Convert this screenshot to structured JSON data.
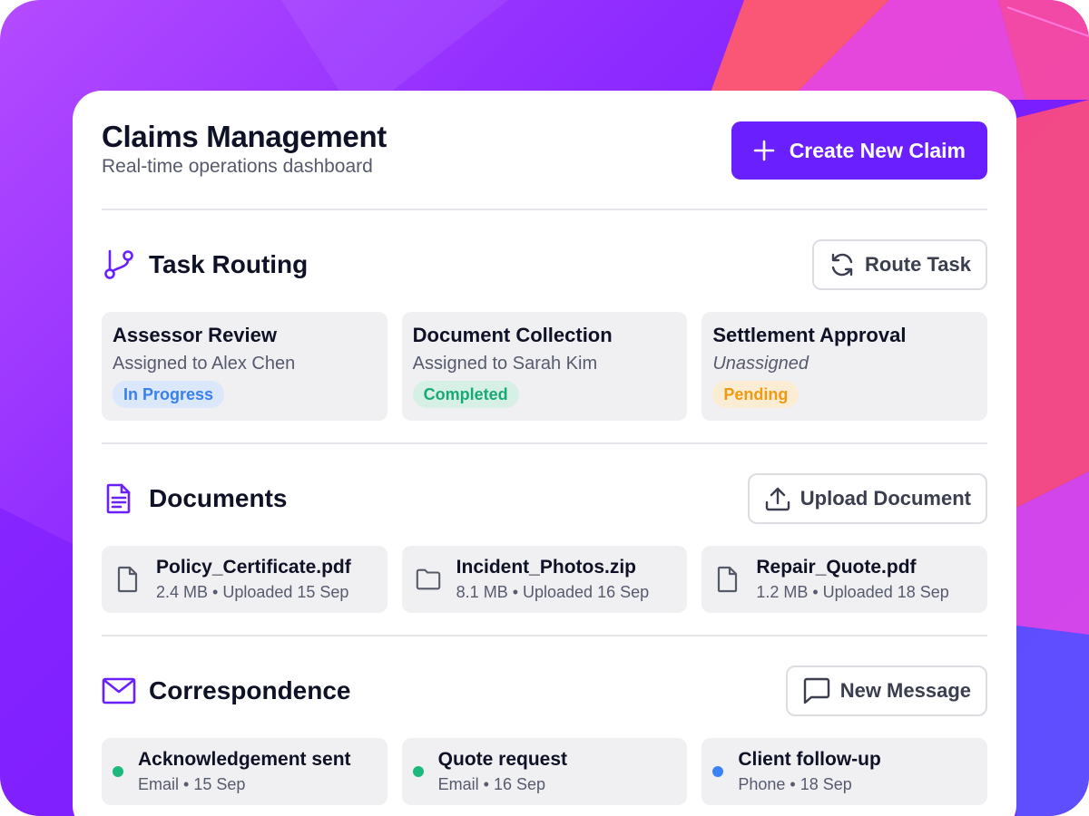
{
  "header": {
    "title": "Claims Management",
    "subtitle": "Real-time operations dashboard",
    "create_label": "Create New Claim"
  },
  "task_routing": {
    "title": "Task Routing",
    "action_label": "Route Task",
    "tasks": [
      {
        "name": "Assessor Review",
        "assignee": "Assigned to Alex Chen",
        "status": "In Progress"
      },
      {
        "name": "Document Collection",
        "assignee": "Assigned to Sarah Kim",
        "status": "Completed"
      },
      {
        "name": "Settlement Approval",
        "assignee": "Unassigned",
        "status": "Pending"
      }
    ]
  },
  "documents": {
    "title": "Documents",
    "action_label": "Upload Document",
    "files": [
      {
        "name": "Policy_Certificate.pdf",
        "meta": "2.4 MB • Uploaded 15 Sep",
        "icon": "file-icon"
      },
      {
        "name": "Incident_Photos.zip",
        "meta": "8.1 MB • Uploaded 16 Sep",
        "icon": "folder-icon"
      },
      {
        "name": "Repair_Quote.pdf",
        "meta": "1.2 MB • Uploaded 18 Sep",
        "icon": "file-icon"
      }
    ]
  },
  "correspondence": {
    "title": "Correspondence",
    "action_label": "New Message",
    "messages": [
      {
        "title": "Acknowledgement sent",
        "meta": "Email • 15 Sep",
        "dot_color": "#1db87e"
      },
      {
        "title": "Quote request",
        "meta": "Email • 16 Sep",
        "dot_color": "#1db87e"
      },
      {
        "title": "Client follow-up",
        "meta": "Phone • 18 Sep",
        "dot_color": "#3b82f6"
      }
    ]
  },
  "colors": {
    "accent": "#6a1fff",
    "in_progress": "#3a80ea",
    "completed": "#1aa876",
    "pending": "#f09a12"
  }
}
